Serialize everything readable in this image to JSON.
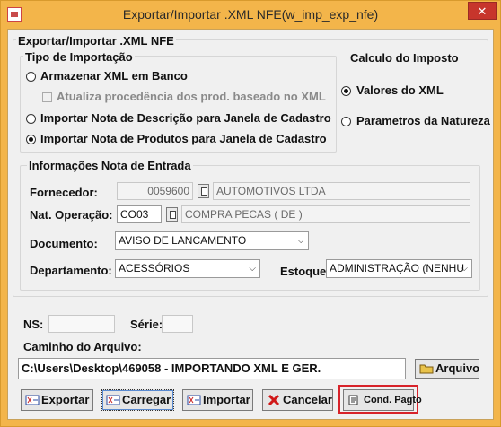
{
  "window": {
    "title": "Exportar/Importar .XML NFE(w_imp_exp_nfe)",
    "close_label": "✕"
  },
  "panel": {
    "title": "Exportar/Importar .XML NFE"
  },
  "tipo": {
    "title": "Tipo de Importação",
    "opt_armazenar": "Armazenar XML em Banco",
    "opt_atualiza": "Atualiza procedência dos prod. baseado no XML",
    "opt_descricao": "Importar Nota de Descrição para Janela de Cadastro",
    "opt_produtos": "Importar Nota de Produtos para Janela de Cadastro"
  },
  "calculo": {
    "title": "Calculo do Imposto",
    "opt_xml": "Valores do XML",
    "opt_natureza": "Parametros da Natureza"
  },
  "info": {
    "title": "Informações Nota de Entrada",
    "fornecedor_label": "Fornecedor:",
    "fornecedor_code": "0059600",
    "fornecedor_name": "AUTOMOTIVOS LTDA",
    "natop_label": "Nat. Operação:",
    "natop_code": "CO03",
    "natop_name": "COMPRA PECAS ( DE )",
    "documento_label": "Documento:",
    "documento_value": "AVISO DE LANCAMENTO",
    "departamento_label": "Departamento:",
    "departamento_value": "ACESSÓRIOS",
    "estoque_label": "Estoque:",
    "estoque_value": "ADMINISTRAÇÃO (NENHU"
  },
  "ns": {
    "label": "NS:",
    "value": ""
  },
  "serie": {
    "label": "Série:",
    "value": ""
  },
  "caminho": {
    "label": "Caminho do Arquivo:",
    "value": "C:\\Users\\Desktop\\469058 - IMPORTANDO XML E GER.",
    "arquivo_btn": "Arquivo"
  },
  "buttons": {
    "exportar": "Exportar",
    "carregar": "Carregar",
    "importar": "Importar",
    "cancelar": "Cancelar",
    "cond_pagto": "Cond. Pagto"
  },
  "colors": {
    "titlebar": "#f3b54a",
    "highlight": "#d8232a",
    "close": "#c7352c"
  }
}
